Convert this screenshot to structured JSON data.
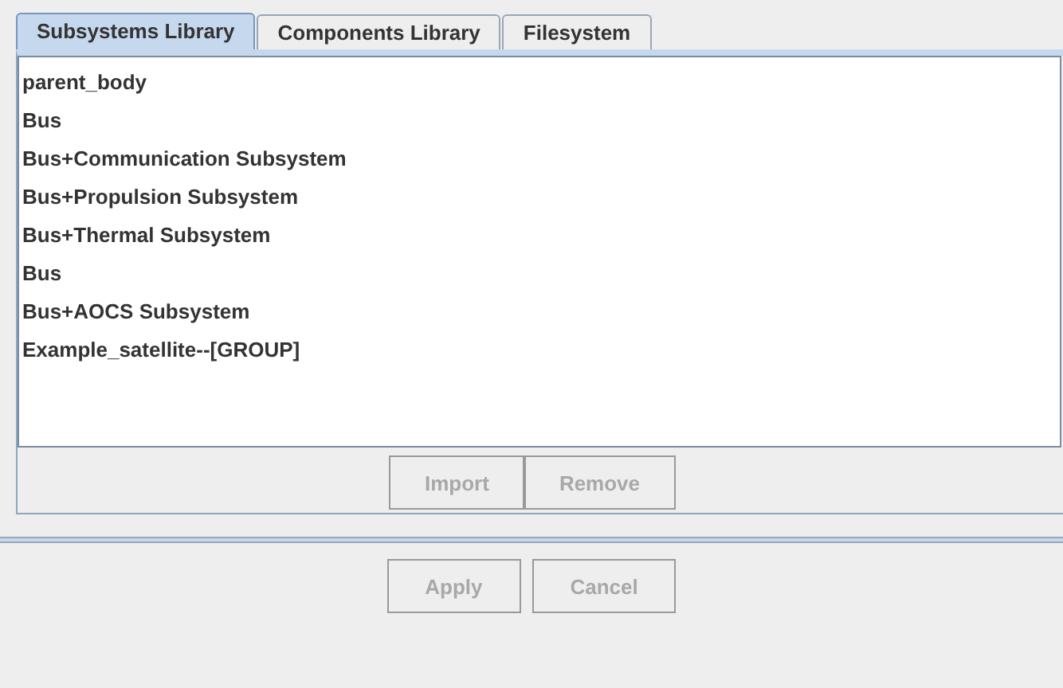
{
  "tabs": [
    {
      "label": "Subsystems Library",
      "selected": true
    },
    {
      "label": "Components Library",
      "selected": false
    },
    {
      "label": "Filesystem",
      "selected": false
    }
  ],
  "list": {
    "items": [
      {
        "label": "parent_body",
        "selected": false
      },
      {
        "label": "Bus",
        "selected": false
      },
      {
        "label": "Bus+Communication Subsystem",
        "selected": false
      },
      {
        "label": "Bus+Propulsion Subsystem",
        "selected": false
      },
      {
        "label": "Bus+Thermal Subsystem",
        "selected": false
      },
      {
        "label": "Bus",
        "selected": false
      },
      {
        "label": "Bus+AOCS Subsystem",
        "selected": false
      },
      {
        "label": "Example_satellite--[GROUP]",
        "selected": false
      }
    ]
  },
  "list_buttons": [
    {
      "label": "Import",
      "disabled": true
    },
    {
      "label": "Remove",
      "disabled": true
    }
  ],
  "dialog_buttons": [
    {
      "label": "Apply",
      "disabled": true
    },
    {
      "label": "Cancel",
      "disabled": true
    }
  ]
}
